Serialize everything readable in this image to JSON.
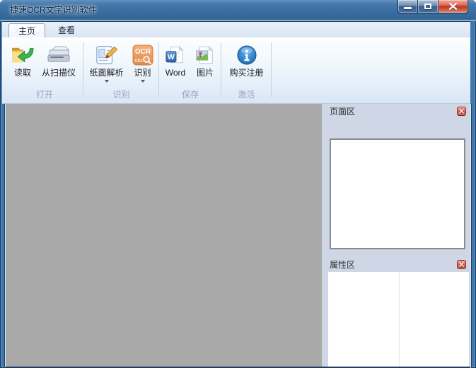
{
  "window": {
    "title": "捷速OCR文字识别软件",
    "controls": [
      {
        "name": "minimize"
      },
      {
        "name": "maximize"
      },
      {
        "name": "close"
      }
    ]
  },
  "tabs": [
    {
      "label": "主页",
      "active": true
    },
    {
      "label": "查看",
      "active": false
    }
  ],
  "ribbon": {
    "groups": [
      {
        "label": "打开",
        "buttons": [
          {
            "label": "读取",
            "icon": "folder-read-icon"
          },
          {
            "label": "从扫描仪",
            "icon": "scanner-icon"
          }
        ]
      },
      {
        "label": "识别",
        "buttons": [
          {
            "label": "纸面解析",
            "icon": "page-analyze-icon",
            "dropdown": true
          },
          {
            "label": "识别",
            "icon": "ocr-icon",
            "dropdown": true
          }
        ]
      },
      {
        "label": "保存",
        "buttons": [
          {
            "label": "Word",
            "icon": "word-doc-icon"
          },
          {
            "label": "图片",
            "icon": "picture-icon"
          }
        ]
      },
      {
        "label": "激活",
        "buttons": [
          {
            "label": "购买注册",
            "icon": "info-icon"
          }
        ]
      }
    ]
  },
  "icons": {
    "ocr_text": "OCR",
    "ocr_subtext": "Abc",
    "word_letter": "W"
  },
  "panels": {
    "page_area": {
      "title": "页面区",
      "close_icon": "close-icon"
    },
    "property_area": {
      "title": "属性区",
      "close_icon": "close-icon"
    }
  },
  "colors": {
    "titlebar_blue": "#3a6fa4",
    "frame_blue": "#3c77ad",
    "ribbon_bg": "#eaf2fb",
    "canvas_gray": "#a9a9a9",
    "sidebar_bg": "#cfd7e7",
    "close_red": "#c23829",
    "group_label_gray": "#96a5b8"
  }
}
